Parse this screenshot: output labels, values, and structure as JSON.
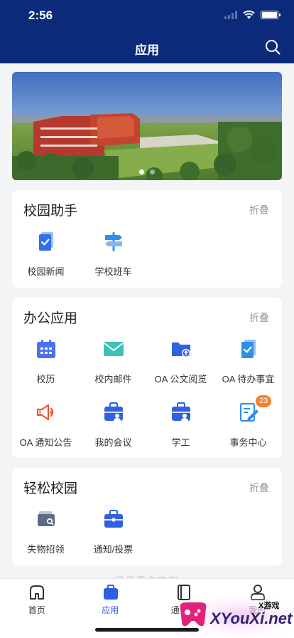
{
  "status_bar": {
    "time": "2:56"
  },
  "header": {
    "title": "应用",
    "search_icon": "search-icon"
  },
  "banner": {
    "slide_count": 2,
    "active_index": 0
  },
  "sections": [
    {
      "title": "校园助手",
      "fold_label": "折叠",
      "apps": [
        {
          "label": "校园新闻",
          "icon": "news-doc-icon",
          "color": "#2f6fe8"
        },
        {
          "label": "学校班车",
          "icon": "signpost-icon",
          "color": "#2f8fe8"
        }
      ]
    },
    {
      "title": "办公应用",
      "fold_label": "折叠",
      "apps": [
        {
          "label": "校历",
          "icon": "calendar-icon",
          "color": "#4a72ee"
        },
        {
          "label": "校内邮件",
          "icon": "mail-icon",
          "color": "#3cc3b6"
        },
        {
          "label": "OA 公文阅览",
          "icon": "folder-upload-icon",
          "color": "#2f62e0"
        },
        {
          "label": "OA 待办事宜",
          "icon": "todo-doc-icon",
          "color": "#2f8fe8"
        },
        {
          "label": "OA 通知公告",
          "icon": "megaphone-icon",
          "color": "#f0522e"
        },
        {
          "label": "我的会议",
          "icon": "meeting-briefcase-icon",
          "color": "#2f62e0"
        },
        {
          "label": "学工",
          "icon": "student-briefcase-icon",
          "color": "#2f62e0"
        },
        {
          "label": "事务中心",
          "icon": "task-edit-icon",
          "color": "#2f8fe8",
          "badge": "23"
        }
      ]
    },
    {
      "title": "轻松校园",
      "fold_label": "折叠",
      "apps": [
        {
          "label": "失物招领",
          "icon": "wallet-search-icon",
          "color": "#5b6d86"
        },
        {
          "label": "通知/投票",
          "icon": "briefcase-icon",
          "color": "#2f62e0"
        }
      ]
    }
  ],
  "hint_text": "已无更多内容",
  "tabbar": [
    {
      "label": "首页",
      "icon": "home-icon",
      "active": false
    },
    {
      "label": "应用",
      "icon": "apps-briefcase-icon",
      "active": true
    },
    {
      "label": "通讯录",
      "icon": "contacts-book-icon",
      "active": false
    },
    {
      "label": "我的",
      "icon": "profile-icon",
      "active": false
    }
  ],
  "watermark": {
    "brand": "XYouXi.net",
    "tag": "X游戏"
  },
  "colors": {
    "header_bg": "#0b2a7a",
    "active_tab": "#2f5fe0",
    "badge": "#f5832b"
  }
}
